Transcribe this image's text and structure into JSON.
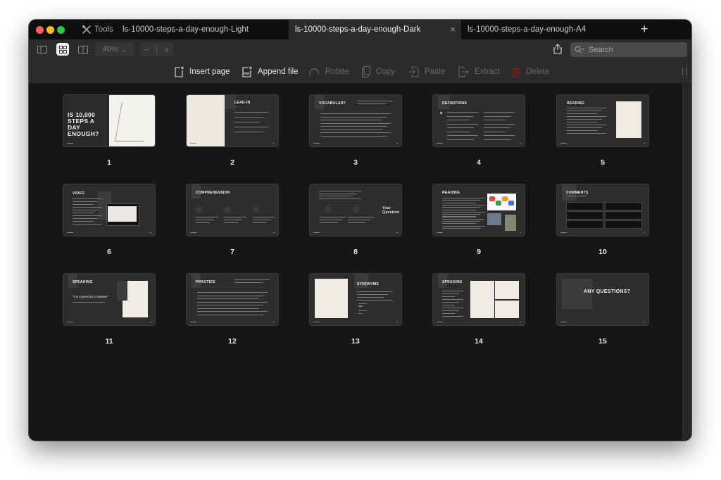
{
  "window": {
    "tools_label": "Tools",
    "tabs": [
      {
        "label": "ls-10000-steps-a-day-enough-Light",
        "active": false
      },
      {
        "label": "ls-10000-steps-a-day-enough-Dark",
        "active": true
      },
      {
        "label": "ls-10000-steps-a-day-enough-A4",
        "active": false
      }
    ],
    "close_tab_glyph": "×",
    "new_tab_glyph": "+"
  },
  "toolbar": {
    "view_modes": [
      "sidebar-view",
      "grid-view",
      "two-page-view"
    ],
    "selected_view": "grid-view",
    "zoom_level": "40%",
    "zoom_out_glyph": "−",
    "zoom_in_glyph": "+",
    "search_placeholder": "Search"
  },
  "actions": [
    {
      "label": "Insert page",
      "icon": "insert-page-icon",
      "enabled": true
    },
    {
      "label": "Append file",
      "icon": "append-pdf-icon",
      "enabled": true
    },
    {
      "label": "Rotate",
      "icon": "rotate-icon",
      "enabled": false
    },
    {
      "label": "Copy",
      "icon": "copy-icon",
      "enabled": false
    },
    {
      "label": "Paste",
      "icon": "paste-icon",
      "enabled": false
    },
    {
      "label": "Extract",
      "icon": "extract-icon",
      "enabled": false
    },
    {
      "label": "Delete",
      "icon": "trash-icon",
      "enabled": false
    }
  ],
  "pages": [
    {
      "number": "1",
      "title": "IS 10,000 STEPS A DAY ENOUGH?",
      "layout": "cover"
    },
    {
      "number": "2",
      "title": "LEAD-IN",
      "layout": "image-left"
    },
    {
      "number": "3",
      "title": "VOCABULARY",
      "layout": "list"
    },
    {
      "number": "4",
      "title": "DEFINITIONS",
      "layout": "two-col"
    },
    {
      "number": "5",
      "title": "READING",
      "layout": "image-right"
    },
    {
      "number": "6",
      "title": "VIDEO",
      "layout": "video"
    },
    {
      "number": "7",
      "title": "COMPREHENSION",
      "layout": "steps"
    },
    {
      "number": "8",
      "title": "Your Question",
      "layout": "steps-right"
    },
    {
      "number": "9",
      "title": "READING",
      "layout": "photos"
    },
    {
      "number": "10",
      "title": "COMMENTS",
      "layout": "comments"
    },
    {
      "number": "11",
      "title": "SPEAKING",
      "layout": "quote"
    },
    {
      "number": "12",
      "title": "PRACTICE",
      "layout": "list"
    },
    {
      "number": "13",
      "title": "SYNONYMS",
      "layout": "image-left-list"
    },
    {
      "number": "14",
      "title": "SPEAKING",
      "layout": "collage"
    },
    {
      "number": "15",
      "title": "ANY QUESTIONS?",
      "layout": "end"
    }
  ],
  "slide_text": {
    "s11_quote": "\"It is a great art to saunter\""
  }
}
